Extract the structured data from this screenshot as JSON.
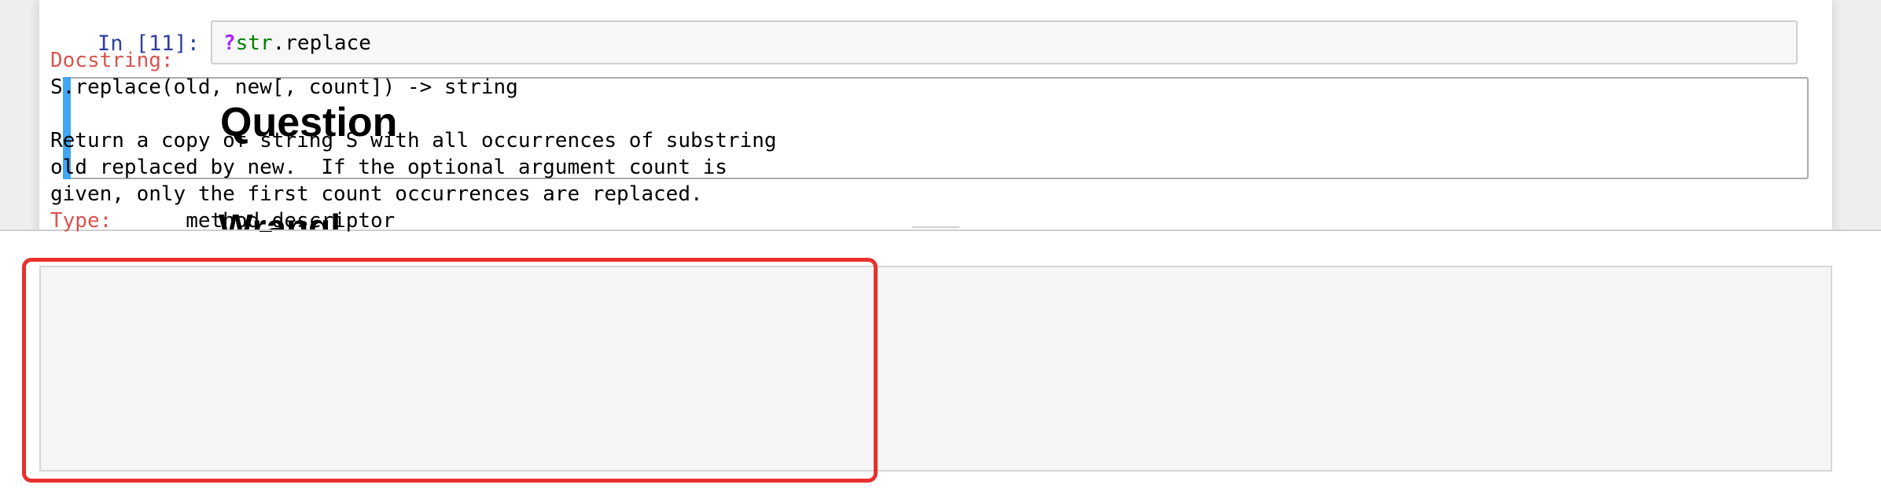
{
  "input_cell": {
    "prompt": "In [11]:",
    "code_prefix": "?",
    "code_builtin": "str",
    "code_rest": ".replace"
  },
  "markdown_cell": {
    "heading": "Question"
  },
  "next_cell": {
    "partial_heading": "Wrangl"
  },
  "pager": {
    "docstring_label": "Docstring:",
    "signature": "S.replace(old, new[, count]) -> string",
    "description_line1": "Return a copy of string S with all occurrences of substring",
    "description_line2": "old replaced by new.  If the optional argument count is",
    "description_line3": "given, only the first count occurrences are replaced.",
    "type_label": "Type:",
    "type_value": "method_descriptor"
  },
  "colors": {
    "prompt_in": "#303f9f",
    "selected_cell_bar": "#42a5f5",
    "docstring_key": "#d9534f",
    "highlight_box": "#e8302d",
    "code_magic": "#aa22ff",
    "code_builtin": "#008000"
  }
}
